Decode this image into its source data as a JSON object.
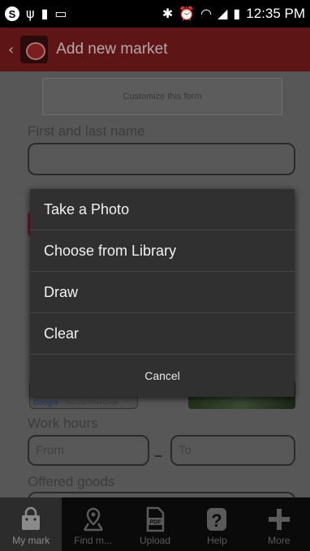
{
  "status_bar": {
    "time": "12:35 PM"
  },
  "app_bar": {
    "title": "Add new market"
  },
  "form": {
    "customize_label": "Customize this form",
    "name_label": "First and last name",
    "work_hours_label": "Work hours",
    "from_placeholder": "From",
    "to_placeholder": "To",
    "dash": "–",
    "offered_goods_label": "Offered goods",
    "map": {
      "brand": "Google",
      "credit": "Map data ©2014 Google"
    }
  },
  "dialog": {
    "options": [
      "Take a Photo",
      "Choose from Library",
      "Draw",
      "Clear"
    ],
    "cancel_label": "Cancel"
  },
  "tab_bar": {
    "tabs": [
      {
        "label": "My mark",
        "icon": "shopping-bag-icon",
        "active": true
      },
      {
        "label": "Find m...",
        "icon": "map-pin-icon",
        "active": false
      },
      {
        "label": "Upload",
        "icon": "pdf-icon",
        "active": false
      },
      {
        "label": "Help",
        "icon": "question-icon",
        "active": false
      },
      {
        "label": "More",
        "icon": "plus-icon",
        "active": false
      }
    ]
  }
}
